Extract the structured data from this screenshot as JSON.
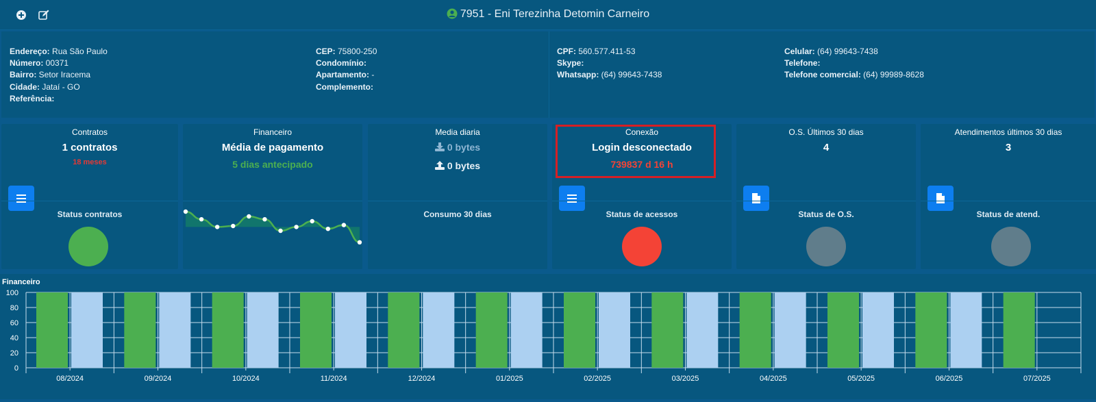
{
  "header": {
    "title": "7951 - Eni Terezinha Detomin Carneiro",
    "add_icon": "plus-circle-icon",
    "edit_icon": "edit-icon"
  },
  "info": {
    "col1": [
      {
        "label": "Endereço:",
        "value": "Rua São Paulo"
      },
      {
        "label": "Número:",
        "value": "00371"
      },
      {
        "label": "Bairro:",
        "value": "Setor Iracema"
      },
      {
        "label": "Cidade:",
        "value": "Jataí - GO"
      },
      {
        "label": "Referência:",
        "value": ""
      }
    ],
    "col2": [
      {
        "label": "CEP:",
        "value": "75800-250"
      },
      {
        "label": "Condomínio:",
        "value": ""
      },
      {
        "label": "Apartamento:",
        "value": "-"
      },
      {
        "label": "Complemento:",
        "value": ""
      }
    ],
    "col3": [
      {
        "label": "CPF:",
        "value": "560.577.411-53"
      },
      {
        "label": "Skype:",
        "value": ""
      },
      {
        "label": "Whatsapp:",
        "value": "(64) 99643-7438"
      }
    ],
    "col4": [
      {
        "label": "Celular:",
        "value": "(64) 99643-7438"
      },
      {
        "label": "Telefone:",
        "value": ""
      },
      {
        "label": "Telefone comercial:",
        "value": "(64) 99989-8628"
      }
    ]
  },
  "cards": {
    "contratos": {
      "title": "Contratos",
      "big": "1 contratos",
      "sub": "18 meses",
      "bottom": "Status contratos",
      "status_color": "#4caf50"
    },
    "financeiro": {
      "title": "Financeiro",
      "big": "Média de pagamento",
      "sub": "5 dias antecipado",
      "sparkline": [
        60,
        52,
        44,
        45,
        55,
        52,
        40,
        44,
        50,
        42,
        46,
        28
      ]
    },
    "media": {
      "title": "Media diaria",
      "download": "0 bytes",
      "upload": "0 bytes",
      "bottom": "Consumo 30 dias"
    },
    "conexao": {
      "title": "Conexão",
      "big": "Login desconectado",
      "sub": "739837 d 16 h",
      "bottom": "Status de acessos",
      "status_color": "#f44336"
    },
    "os": {
      "title": "O.S. Últimos 30 dias",
      "big": "4",
      "bottom": "Status de O.S.",
      "status_color": "#607d8b"
    },
    "atend": {
      "title": "Atendimentos últimos 30 dias",
      "big": "3",
      "bottom": "Status de atend.",
      "status_color": "#607d8b"
    }
  },
  "chart_data": {
    "type": "bar",
    "title": "Financeiro",
    "categories": [
      "08/2024",
      "09/2024",
      "10/2024",
      "11/2024",
      "12/2024",
      "01/2025",
      "02/2025",
      "03/2025",
      "04/2025",
      "05/2025",
      "06/2025",
      "07/2025"
    ],
    "series": [
      {
        "color": "#4caf50",
        "values": [
          100,
          100,
          100,
          100,
          100,
          100,
          100,
          100,
          100,
          100,
          100,
          100
        ]
      },
      {
        "color": "#acd0f1",
        "values": [
          100,
          100,
          100,
          100,
          100,
          100,
          100,
          100,
          100,
          100,
          100,
          0
        ]
      }
    ],
    "ylim": [
      0,
      100
    ],
    "yticks": [
      0,
      20,
      40,
      60,
      80,
      100
    ],
    "grid": true
  }
}
